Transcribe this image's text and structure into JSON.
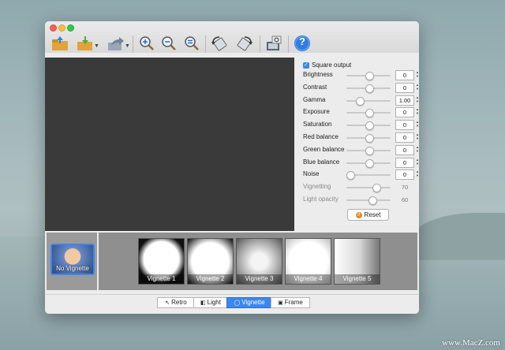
{
  "toolbar": {
    "buttons": [
      {
        "icon": "open-folder-icon"
      },
      {
        "icon": "save-icon"
      },
      {
        "icon": "share-icon"
      },
      {
        "icon": "zoom-in-icon"
      },
      {
        "icon": "zoom-out-icon"
      },
      {
        "icon": "zoom-fit-icon"
      },
      {
        "icon": "rotate-left-icon"
      },
      {
        "icon": "rotate-right-icon"
      },
      {
        "icon": "compare-icon"
      },
      {
        "icon": "help-icon"
      }
    ],
    "help_label": "?"
  },
  "panel": {
    "square_output": {
      "label": "Square output",
      "checked": true
    },
    "sliders": [
      {
        "label": "Brightness",
        "value": "0",
        "level": 0.5,
        "enabled": true
      },
      {
        "label": "Contrast",
        "value": "0",
        "level": 0.5,
        "enabled": true
      },
      {
        "label": "Gamma",
        "value": "1.00",
        "level": 0.25,
        "enabled": true
      },
      {
        "label": "Exposure",
        "value": "0",
        "level": 0.5,
        "enabled": true
      },
      {
        "label": "Saturation",
        "value": "0",
        "level": 0.5,
        "enabled": true
      },
      {
        "label": "Red balance",
        "value": "0",
        "level": 0.5,
        "enabled": true
      },
      {
        "label": "Green balance",
        "value": "0",
        "level": 0.5,
        "enabled": true
      },
      {
        "label": "Blue balance",
        "value": "0",
        "level": 0.5,
        "enabled": true
      },
      {
        "label": "Noise",
        "value": "0",
        "level": 0.0,
        "enabled": true
      },
      {
        "label": "Vignetting",
        "value": "70",
        "level": 0.7,
        "enabled": false
      },
      {
        "label": "Light opacity",
        "value": "60",
        "level": 0.6,
        "enabled": false
      }
    ],
    "reset_label": "Reset"
  },
  "presets": {
    "current_label": "No Vignette",
    "items": [
      {
        "label": "Vignette 1"
      },
      {
        "label": "Vignette 2"
      },
      {
        "label": "Vignette 3"
      },
      {
        "label": "Vignette 4"
      },
      {
        "label": "Vignette 5"
      }
    ]
  },
  "tabs": [
    {
      "label": "Retro",
      "icon": "wand-icon",
      "selected": false
    },
    {
      "label": "Light",
      "icon": "light-icon",
      "selected": false
    },
    {
      "label": "Vignette",
      "icon": "vignette-icon",
      "selected": true
    },
    {
      "label": "Frame",
      "icon": "frame-icon",
      "selected": false
    }
  ],
  "watermark": "www.MacZ.com",
  "colors": {
    "accent": "#3b87f0",
    "preview_bg": "#3a3a3a",
    "reset_icon": "#e8881e"
  }
}
